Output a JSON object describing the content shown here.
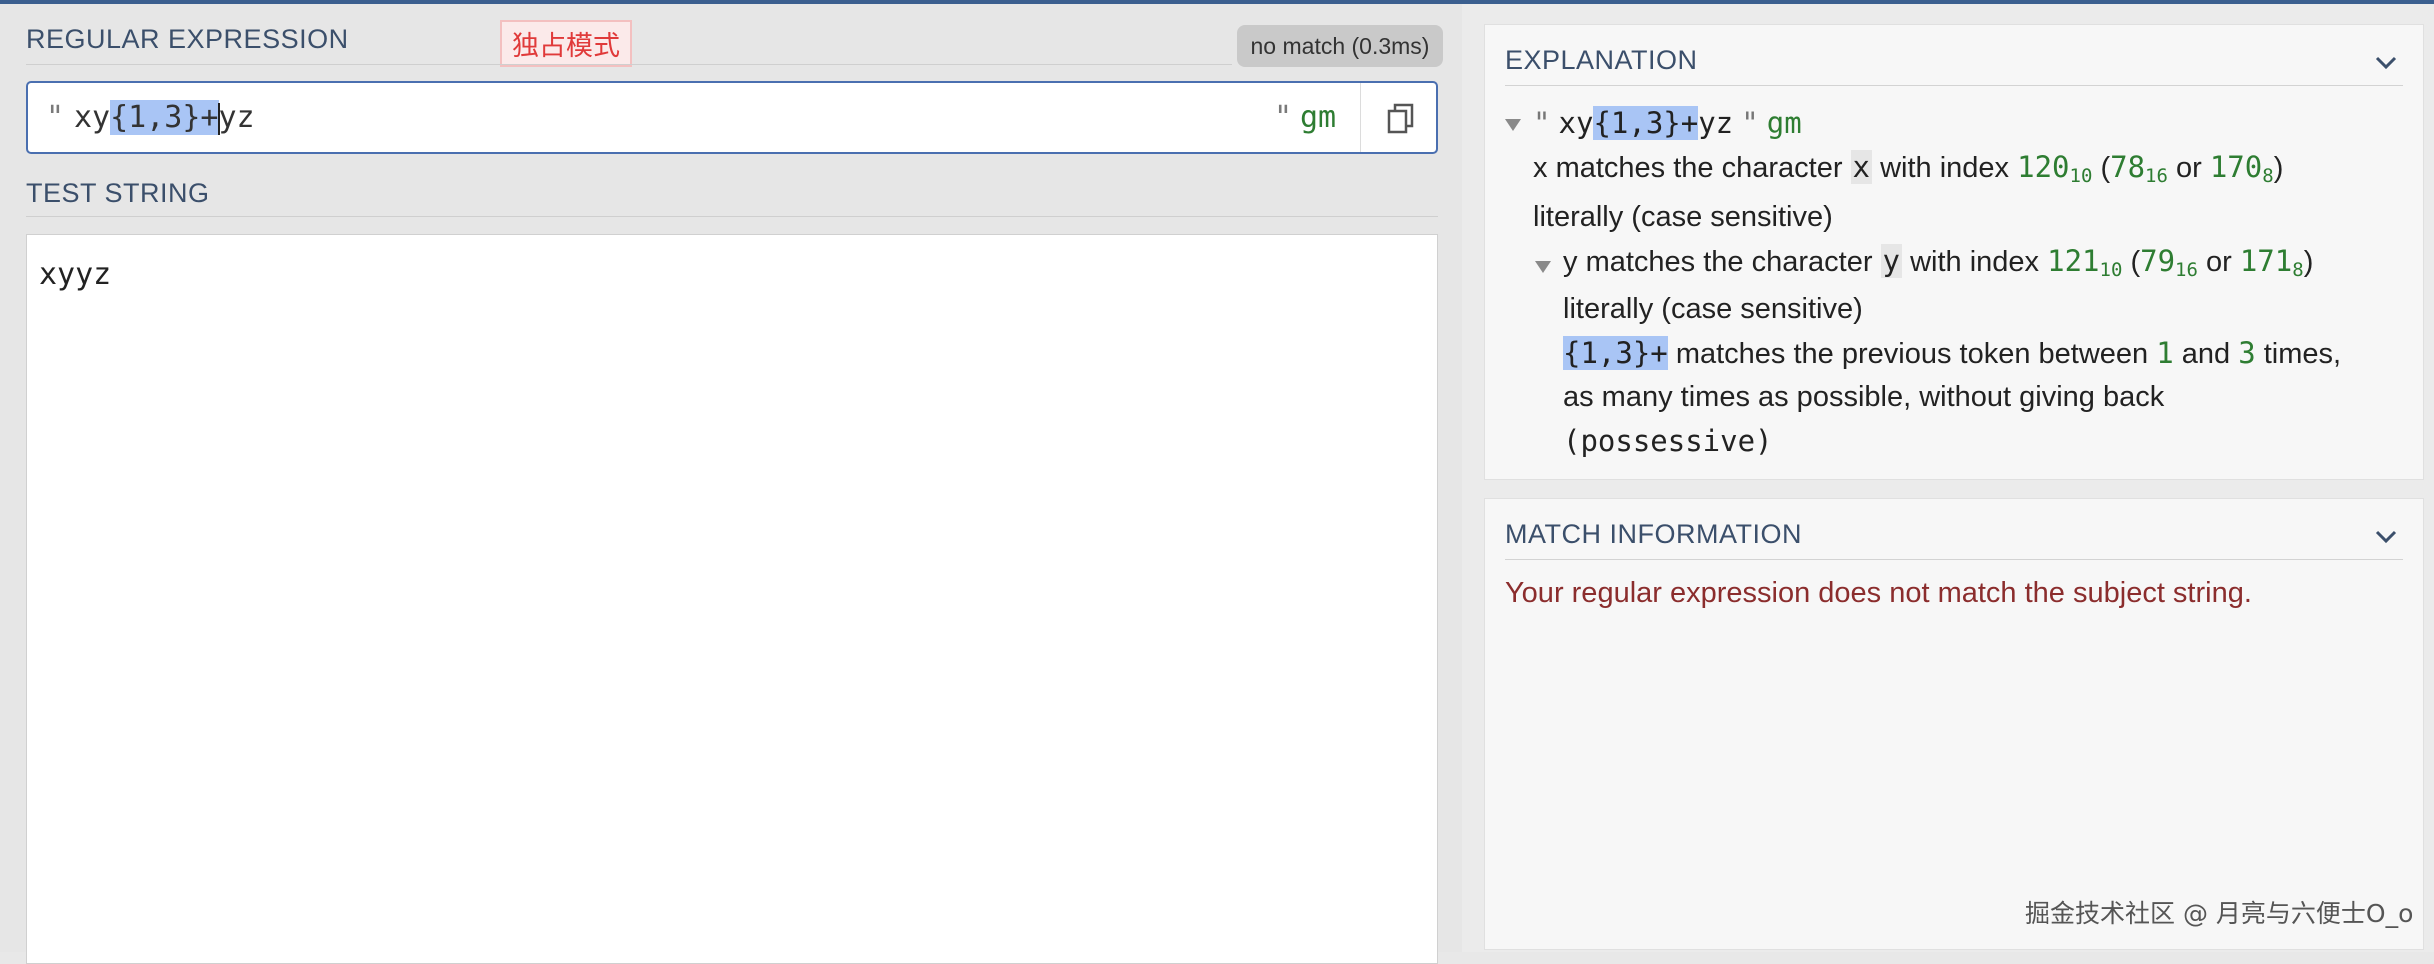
{
  "regex_panel": {
    "title": "REGULAR EXPRESSION",
    "annotation": "独占模式",
    "status": "no match (0.3ms)",
    "delimiter_open": "\"",
    "pattern_before": "xy",
    "pattern_quantifier": "{1,3}+",
    "pattern_after": "yz",
    "delimiter_close": "\"",
    "flags": "gm"
  },
  "test_panel": {
    "title": "TEST STRING",
    "value": "xyyz"
  },
  "explanation": {
    "title": "EXPLANATION",
    "root_quote_open": "\"",
    "root_before": "xy",
    "root_quantifier": "{1,3}+",
    "root_after": "yz",
    "root_quote_close": "\"",
    "root_flags": "gm",
    "x": {
      "token": "x",
      "text1": "matches the character",
      "char": "x",
      "text2": "with index",
      "dec": "120",
      "dec_base": "10",
      "hex": "78",
      "hex_base": "16",
      "or_text": "or",
      "oct": "170",
      "oct_base": "8",
      "line2": "literally (case sensitive)"
    },
    "y": {
      "token": "y",
      "text1": "matches the character",
      "char": "y",
      "text2": "with index",
      "dec": "121",
      "dec_base": "10",
      "hex": "79",
      "hex_base": "16",
      "or_text": "or",
      "oct": "171",
      "oct_base": "8",
      "line2": "literally (case sensitive)"
    },
    "quantifier": {
      "token": "{1,3}+",
      "text1": "matches the previous token between",
      "min": "1",
      "and_text": "and",
      "max": "3",
      "text2": "times,",
      "line2": "as many times as possible, without giving back",
      "line3": "(possessive)"
    }
  },
  "match_info": {
    "title": "MATCH INFORMATION",
    "message": "Your regular expression does not match the subject string."
  },
  "watermark": "掘金技术社区 @ 月亮与六便士O_o",
  "colors": {
    "accent": "#4a6fb0",
    "highlight": "#a9c5f5",
    "flag_green": "#2e7d32",
    "error_red": "#8b2d2d",
    "annotation_red": "#e03a3a"
  },
  "icons": {
    "copy": "copy-icon",
    "chevron": "chevron-down-icon",
    "expand": "triangle-down-icon"
  }
}
